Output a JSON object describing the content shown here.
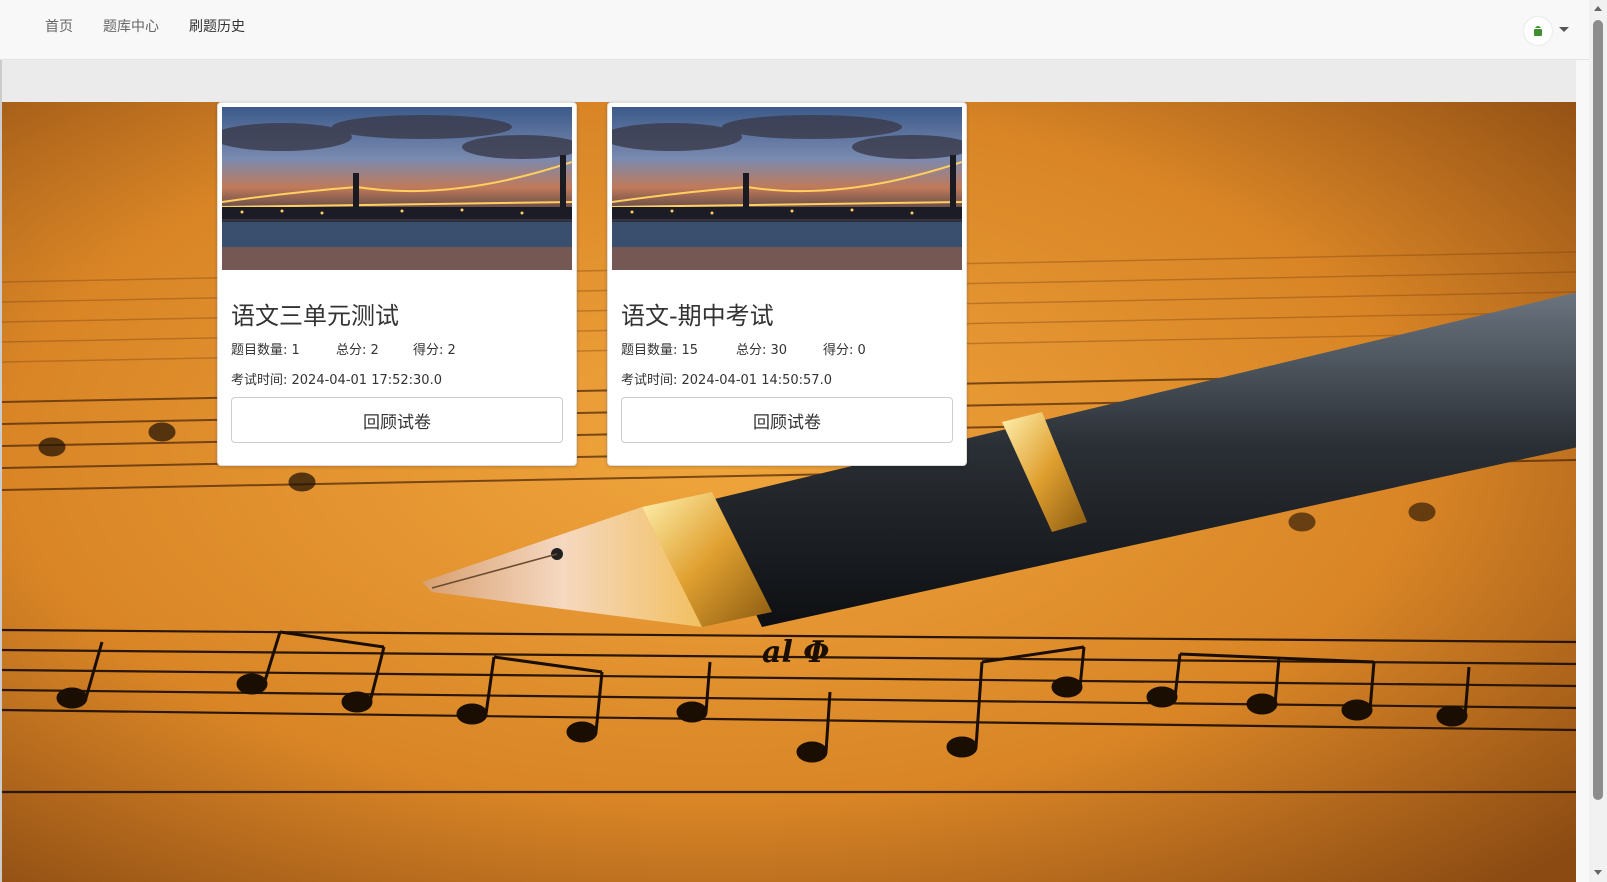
{
  "nav": {
    "items": [
      {
        "label": "首页"
      },
      {
        "label": "题库中心"
      },
      {
        "label": "刷题历史"
      }
    ]
  },
  "cards": [
    {
      "title": "语文三单元测试",
      "question_count": "题目数量: 1",
      "total_score": "总分: 2",
      "score": "得分: 2",
      "exam_time": "考试时间: 2024-04-01 17:52:30.0",
      "button": "回顾试卷"
    },
    {
      "title": "语文-期中考试",
      "question_count": "题目数量: 15",
      "total_score": "总分: 30",
      "score": "得分: 0",
      "exam_time": "考试时间: 2024-04-01 14:50:57.0",
      "button": "回顾试卷"
    }
  ],
  "hero_text": "al Φ",
  "colors": {
    "navbar_bg": "#f8f8f8",
    "hero_orange": "#d9862a",
    "card_bg": "#ffffff",
    "text": "#333333"
  }
}
